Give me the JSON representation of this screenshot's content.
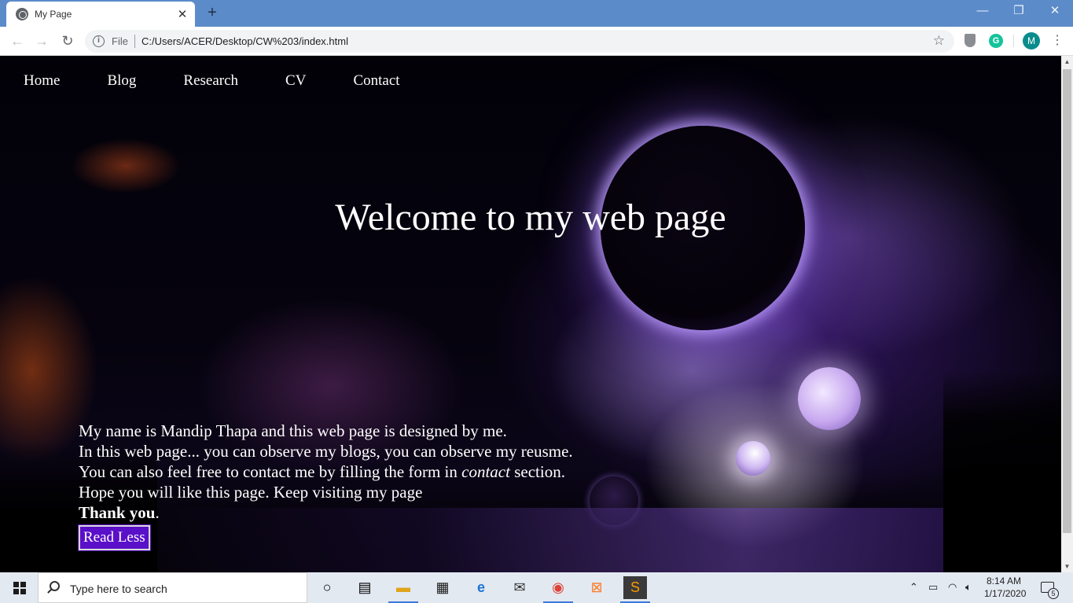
{
  "browser": {
    "tab_title": "My Page",
    "tab_close": "✕",
    "new_tab": "+",
    "window_controls": {
      "minimize": "—",
      "restore": "❐",
      "close": "✕"
    },
    "url_scheme": "File",
    "url": "C:/Users/ACER/Desktop/CW%203/index.html",
    "profile_initial": "M",
    "grammarly_letter": "G"
  },
  "site": {
    "nav": [
      "Home",
      "Blog",
      "Research",
      "CV",
      "Contact"
    ],
    "hero_title": "Welcome to my web page",
    "intro": {
      "line1": "My name is Mandip Thapa and this web page is designed by me.",
      "line2": "In this web page... you can observe my blogs, you can observe my reusme.",
      "line3_pre": "You can also feel free to contact me by filling the form in ",
      "line3_em": "contact",
      "line3_post": " section.",
      "line4": "Hope you will like this page. Keep visiting my page",
      "thanks_bold": "Thank you",
      "thanks_tail": "."
    },
    "button_label": "Read Less"
  },
  "taskbar": {
    "search_placeholder": "Type here to search",
    "time": "8:14 AM",
    "date": "1/17/2020",
    "notification_count": "5"
  }
}
